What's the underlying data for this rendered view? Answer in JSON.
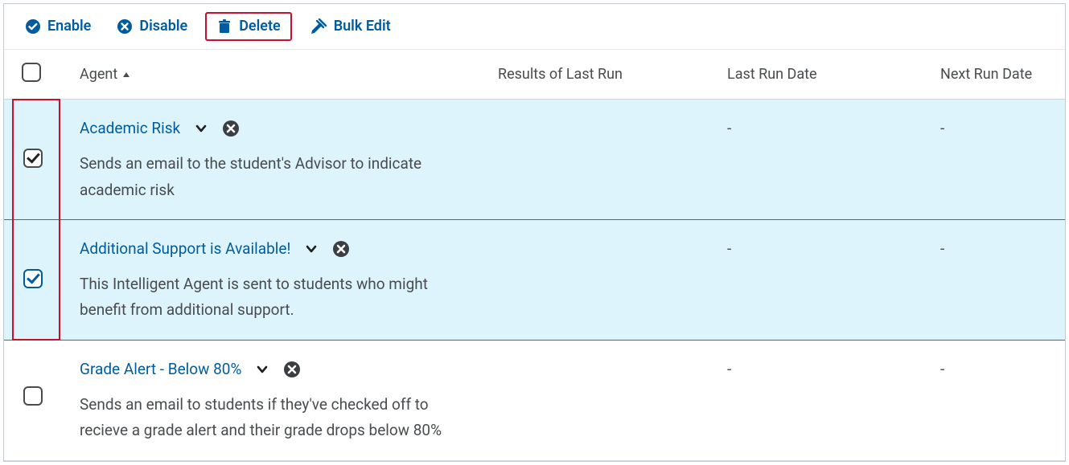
{
  "toolbar": {
    "enable": "Enable",
    "disable": "Disable",
    "delete": "Delete",
    "bulk_edit": "Bulk Edit"
  },
  "columns": {
    "agent": "Agent",
    "results": "Results of Last Run",
    "last_run": "Last Run Date",
    "next_run": "Next Run Date"
  },
  "rows": [
    {
      "checked": true,
      "selected": true,
      "title": "Academic Risk",
      "description": "Sends an email to the student's Advisor to indicate academic risk",
      "results": "",
      "last_run": "-",
      "next_run": "-"
    },
    {
      "checked": true,
      "selected": true,
      "title": "Additional Support is Available!",
      "description": "This Intelligent Agent is sent to students who might benefit from additional support.",
      "results": "",
      "last_run": "-",
      "next_run": "-"
    },
    {
      "checked": false,
      "selected": false,
      "title": "Grade Alert - Below 80%",
      "description": "Sends an email to students if they've checked off to recieve a grade alert and their grade drops below 80%",
      "results": "",
      "last_run": "-",
      "next_run": "-"
    }
  ],
  "colors": {
    "link": "#005c9e",
    "highlight_border": "#c8102e",
    "selected_bg": "#def4fc"
  }
}
